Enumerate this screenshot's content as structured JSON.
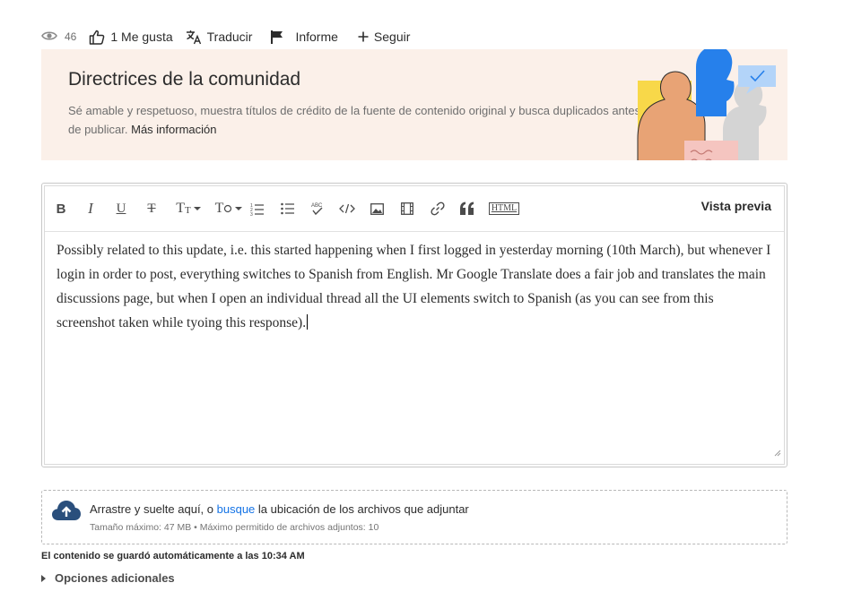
{
  "actions": {
    "views": "46",
    "like": "1 Me gusta",
    "translate": "Traducir",
    "report": "Informe",
    "follow": "Seguir"
  },
  "banner": {
    "title": "Directrices de la comunidad",
    "text": "Sé amable y respetuoso, muestra títulos de crédito de la fuente de contenido original y busca duplicados antes de publicar.",
    "link": "Más información"
  },
  "editor": {
    "toolbar": {
      "bold": "B",
      "italic": "I",
      "underline": "U",
      "strike": "T",
      "font_size": "T",
      "text_style": "T",
      "preview": "Vista previa",
      "html": "HTML"
    },
    "body": "Possibly related to this update, i.e. this started happening when I first logged in  yesterday morning (10th March), but whenever I login in order to post, everything switches to Spanish from English. Mr Google Translate does a fair job and translates the main discussions page, but when I open an individual thread all the UI elements switch to Spanish (as you can see from this screenshot taken while tyoing this response)."
  },
  "upload": {
    "text_before": "Arrastre y suelte aquí, o ",
    "link": "busque",
    "text_after": " la ubicación de los archivos que adjuntar",
    "limits": "Tamaño máximo: 47 MB • Máximo permitido de archivos adjuntos: 10"
  },
  "autosave": "El contenido se guardó automáticamente a las 10:34 AM",
  "more_options": "Opciones adicionales",
  "colors": {
    "banner_bg": "#fbf0e9",
    "link_blue": "#1473e6",
    "art_blue": "#2680eb",
    "art_yellow": "#f8d849",
    "art_orange": "#e8a375",
    "art_pink": "#f5c5c0",
    "art_gray": "#d4d4d4"
  }
}
